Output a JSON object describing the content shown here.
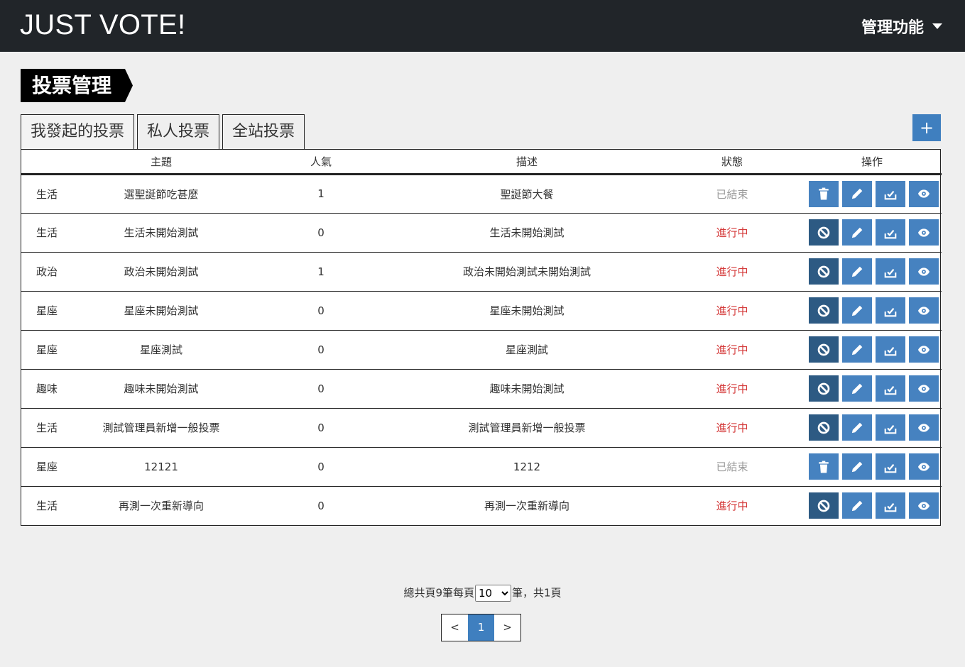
{
  "app": {
    "brand": "JUST VOTE!",
    "admin_menu": "管理功能"
  },
  "page": {
    "title": "投票管理"
  },
  "tabs": [
    {
      "label": "我發起的投票",
      "active": true
    },
    {
      "label": "私人投票",
      "active": false
    },
    {
      "label": "全站投票",
      "active": false
    }
  ],
  "add_button": {
    "label": "+"
  },
  "table": {
    "headers": [
      "",
      "主題",
      "人氣",
      "描述",
      "狀態",
      "操作"
    ],
    "rows": [
      {
        "category": "生活",
        "title": "選聖誕節吃甚麼",
        "popularity": "1",
        "description": "聖誕節大餐",
        "status": "已結束",
        "ended": true
      },
      {
        "category": "生活",
        "title": "生活未開始測試",
        "popularity": "0",
        "description": "生活未開始測試",
        "status": "進行中",
        "ended": false
      },
      {
        "category": "政治",
        "title": "政治未開始測試",
        "popularity": "1",
        "description": "政治未開始測試未開始測試",
        "status": "進行中",
        "ended": false
      },
      {
        "category": "星座",
        "title": "星座未開始測試",
        "popularity": "0",
        "description": "星座未開始測試",
        "status": "進行中",
        "ended": false
      },
      {
        "category": "星座",
        "title": "星座測試",
        "popularity": "0",
        "description": "星座測試",
        "status": "進行中",
        "ended": false
      },
      {
        "category": "趣味",
        "title": "趣味未開始測試",
        "popularity": "0",
        "description": "趣味未開始測試",
        "status": "進行中",
        "ended": false
      },
      {
        "category": "生活",
        "title": "測試管理員新增一般投票",
        "popularity": "0",
        "description": "測試管理員新增一般投票",
        "status": "進行中",
        "ended": false
      },
      {
        "category": "星座",
        "title": "12121",
        "popularity": "0",
        "description": "1212",
        "status": "已結束",
        "ended": true
      },
      {
        "category": "生活",
        "title": "再測一次重新導向",
        "popularity": "0",
        "description": "再測一次重新導向",
        "status": "進行中",
        "ended": false
      }
    ]
  },
  "pager": {
    "prefix": "總共頁9筆每頁",
    "per_page": "10",
    "per_page_options": [
      "10"
    ],
    "suffix": "筆，共1頁",
    "prev": "<",
    "current": "1",
    "next": ">"
  },
  "colors": {
    "nav": "#212529",
    "primary": "#4682c0",
    "primary_dark": "#2d5a83",
    "ongoing": "#d43a3a",
    "ended": "#9a9a9a"
  }
}
